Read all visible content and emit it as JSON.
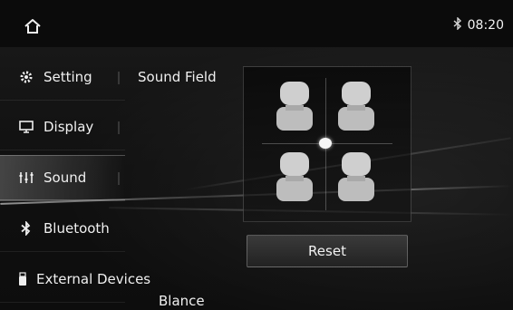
{
  "status": {
    "time": "08:20",
    "bluetooth_icon": "bluetooth-icon"
  },
  "sidebar": {
    "items": [
      {
        "label": "Setting",
        "icon": "gear-icon"
      },
      {
        "label": "Display",
        "icon": "monitor-icon"
      },
      {
        "label": "Sound",
        "icon": "equalizer-icon",
        "active": true
      },
      {
        "label": "Bluetooth",
        "icon": "bluetooth-icon"
      },
      {
        "label": "External Devices",
        "icon": "usb-icon"
      }
    ]
  },
  "sound": {
    "section_label": "Sound  Field",
    "reset_label": "Reset",
    "bottom_label": "Blance"
  }
}
